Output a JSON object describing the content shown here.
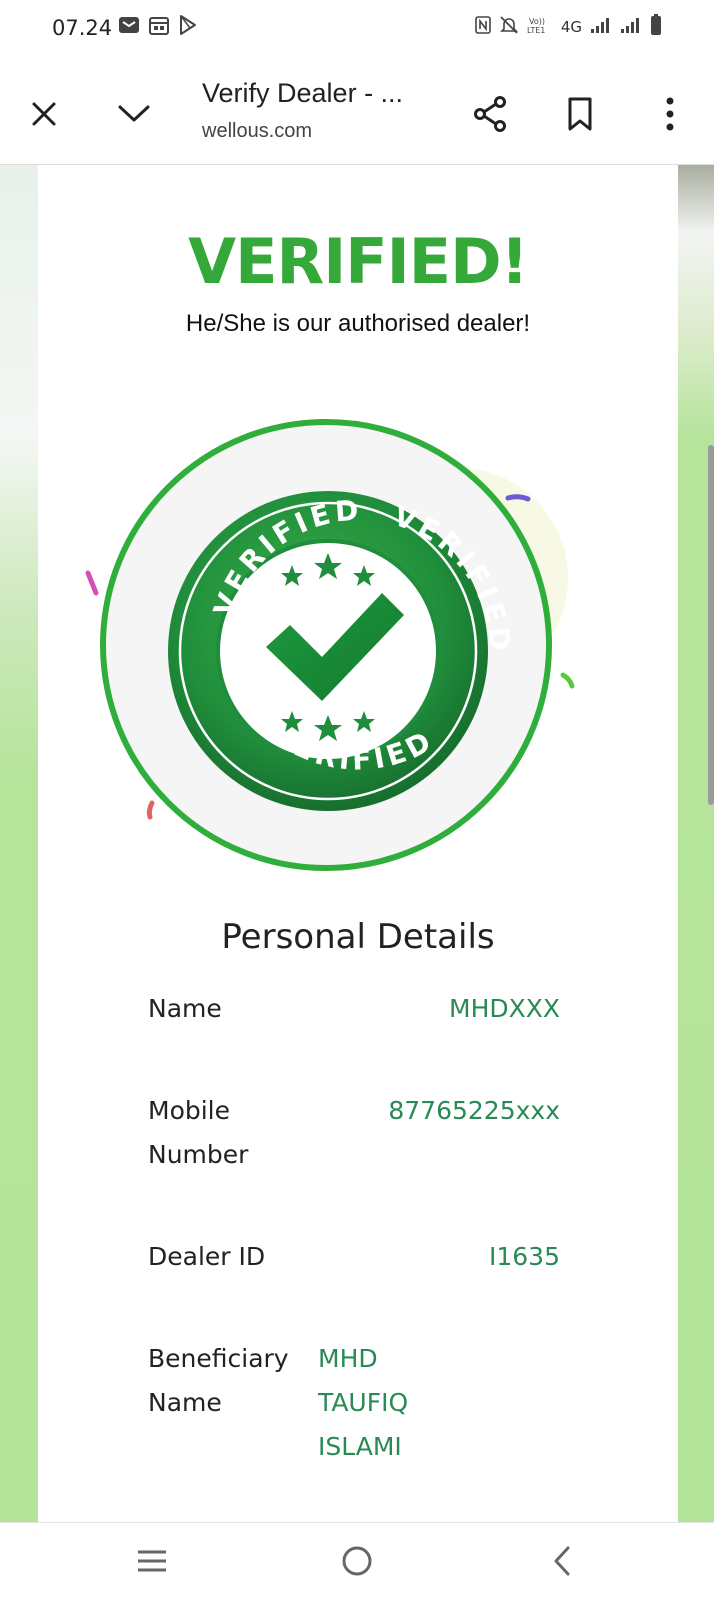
{
  "status_bar": {
    "time": "07.24",
    "network": "4G"
  },
  "browser": {
    "page_title": "Verify Dealer - ...",
    "domain": "wellous.com"
  },
  "page": {
    "heading": "VERIFIED!",
    "subheading": "He/She is our authorised dealer!",
    "badge_text": "VERIFIED",
    "section_title": "Personal Details",
    "details": [
      {
        "label": "Name",
        "value": "MHDXXX"
      },
      {
        "label": "Mobile Number",
        "value": "87765225xxx"
      },
      {
        "label": "Dealer ID",
        "value": "I1635"
      },
      {
        "label": "Beneficiary Name",
        "value": "MHD TAUFIQ ISLAMI"
      }
    ]
  },
  "colors": {
    "accent_green": "#35a83a",
    "value_green": "#2a8a55",
    "side_bg": "#b6e49b"
  }
}
